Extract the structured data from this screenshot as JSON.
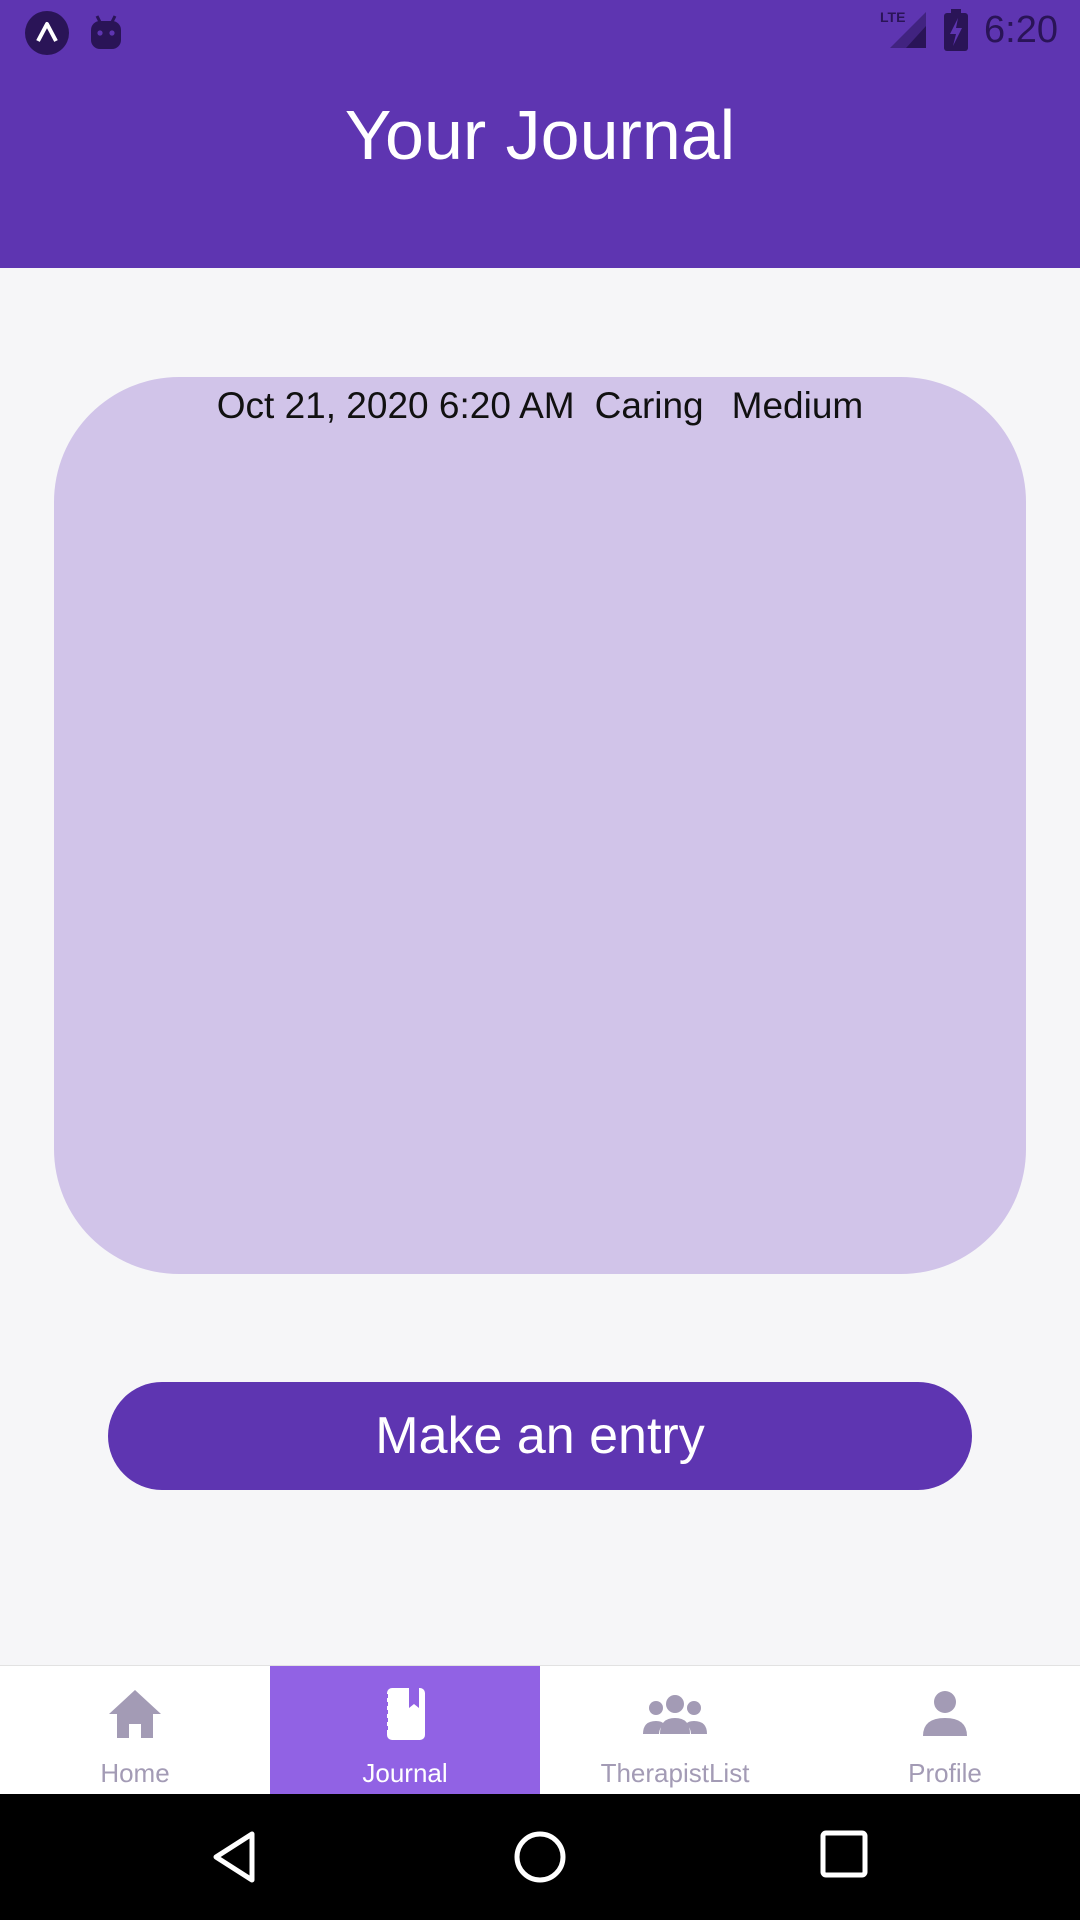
{
  "status_bar": {
    "time": "6:20",
    "network": "LTE",
    "icons": [
      "app-a-icon",
      "android-icon",
      "lte-signal-icon",
      "battery-charging-icon"
    ]
  },
  "header": {
    "title": "Your Journal"
  },
  "entry": {
    "date": "Oct 21, 2020 6:20 AM",
    "emotion": "Caring",
    "intensity": "Medium"
  },
  "actions": {
    "make_entry_label": "Make an entry"
  },
  "bottom_nav": {
    "items": [
      {
        "label": "Home",
        "icon": "home-icon",
        "active": false
      },
      {
        "label": "Journal",
        "icon": "journal-icon",
        "active": true
      },
      {
        "label": "TherapistList",
        "icon": "group-icon",
        "active": false
      },
      {
        "label": "Profile",
        "icon": "person-icon",
        "active": false
      }
    ]
  },
  "system_nav": {
    "icons": [
      "back-icon",
      "home-circle-icon",
      "recents-icon"
    ]
  },
  "colors": {
    "primary": "#5e35b1",
    "card": "#d1c4e9",
    "nav_active": "#9162e4",
    "nav_inactive": "#a39bb5"
  }
}
